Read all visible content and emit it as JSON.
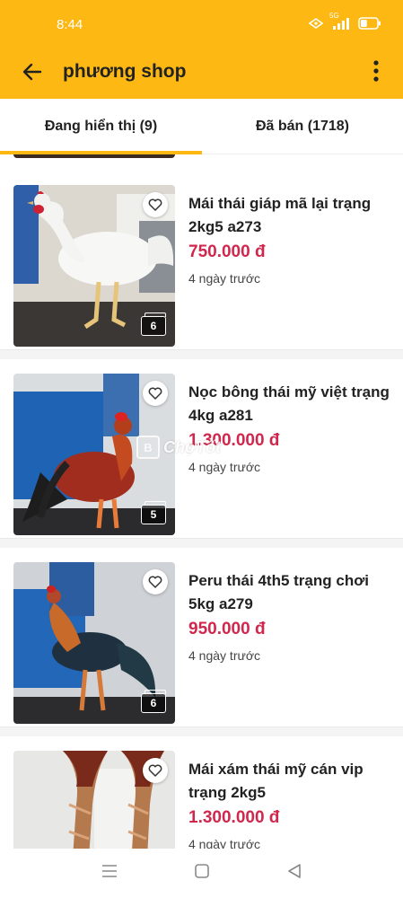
{
  "status_bar": {
    "time": "8:44",
    "network_label": "5G",
    "battery_level": 0.4
  },
  "app_bar": {
    "title": "phương shop"
  },
  "tabs": [
    {
      "label": "Đang hiển thị (9)",
      "active": true
    },
    {
      "label": "Đã bán (1718)",
      "active": false
    }
  ],
  "listings": [
    {
      "title": "Mái thái giáp mã lại trạng 2kg5 a273",
      "price": "750.000 đ",
      "time": "4 ngày trước",
      "photo_count": "6"
    },
    {
      "title": "Nọc bông thái mỹ việt trạng 4kg a281",
      "price": "1.300.000 đ",
      "time": "4 ngày trước",
      "photo_count": "5"
    },
    {
      "title": "Peru thái 4th5 trạng chơi 5kg a279",
      "price": "950.000 đ",
      "time": "4 ngày trước",
      "photo_count": "6"
    },
    {
      "title": "Mái xám thái mỹ cán vip trạng 2kg5",
      "price": "1.300.000 đ",
      "time": "4 ngày trước",
      "photo_count": ""
    }
  ],
  "watermark": {
    "box": "B",
    "text": "ChợTốt"
  },
  "theme": {
    "accent": "#fdb813",
    "price": "#d0284d",
    "text": "#222222"
  },
  "icons": {
    "back": "arrow-left-icon",
    "more": "more-vertical-icon",
    "favorite": "heart-outline-icon",
    "photos": "photo-stack-icon",
    "nav_menu": "menu-icon",
    "nav_home": "square-icon",
    "nav_back": "triangle-back-icon"
  }
}
